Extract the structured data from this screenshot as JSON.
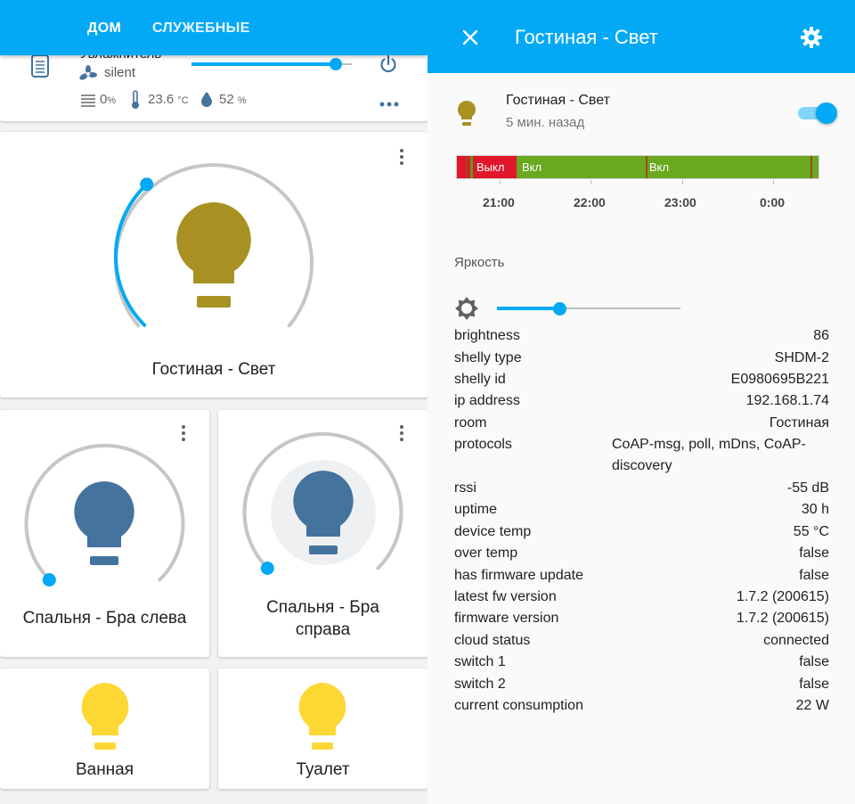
{
  "tabs": [
    "ДОМ",
    "СЛУЖЕБНЫЕ"
  ],
  "humidifier": {
    "label": "Увлажнитель",
    "mode": "silent",
    "water_value": "0",
    "water_unit": "%",
    "temp_value": "23.6",
    "temp_unit": "°C",
    "humidity_value": "52",
    "humidity_unit": "%",
    "slider_fraction": 0.9
  },
  "lights": {
    "living": {
      "name": "Гостиная - Свет",
      "brightness_fraction": 0.34
    },
    "bed_left": {
      "name": "Спальня - Бра слева",
      "brightness_fraction": 0.0
    },
    "bed_right": {
      "name": "Спальня - Бра справа",
      "brightness_fraction": 0.0
    },
    "bath": {
      "name": "Ванная"
    },
    "toilet": {
      "name": "Туалет"
    }
  },
  "dialog": {
    "title": "Гостиная - Свет",
    "entity_name": "Гостиная - Свет",
    "last_changed": "5 мин. назад",
    "toggle_on": true,
    "timeline": {
      "segments": [
        {
          "label": "Выкл",
          "state": "off"
        },
        {
          "label": "Вкл",
          "state": "on"
        },
        {
          "label": "Вкл",
          "state": "on"
        }
      ],
      "ticks": [
        "21:00",
        "22:00",
        "23:00",
        "0:00"
      ]
    },
    "brightness_label": "Яркость",
    "brightness_slider_fraction": 0.34,
    "attributes": [
      {
        "key": "brightness",
        "value": "86"
      },
      {
        "key": "shelly type",
        "value": "SHDM-2"
      },
      {
        "key": "shelly id",
        "value": "E0980695B221"
      },
      {
        "key": "ip address",
        "value": "192.168.1.74"
      },
      {
        "key": "room",
        "value": "Гостиная"
      },
      {
        "key": "protocols",
        "value": "CoAP-msg, poll, mDns, CoAP-discovery"
      },
      {
        "key": "rssi",
        "value": "-55 dB"
      },
      {
        "key": "uptime",
        "value": "30 h"
      },
      {
        "key": "device temp",
        "value": "55 °C"
      },
      {
        "key": "over temp",
        "value": "false"
      },
      {
        "key": "has firmware update",
        "value": "false"
      },
      {
        "key": "latest fw version",
        "value": "1.7.2 (200615)"
      },
      {
        "key": "firmware version",
        "value": "1.7.2 (200615)"
      },
      {
        "key": "cloud status",
        "value": "connected"
      },
      {
        "key": "switch 1",
        "value": "false"
      },
      {
        "key": "switch 2",
        "value": "false"
      },
      {
        "key": "current consumption",
        "value": "22 W"
      }
    ]
  },
  "colors": {
    "accent": "#03a9f4",
    "bulb_on_dim": "#a89122",
    "bulb_off": "#44739e",
    "bulb_on_bright": "#fdd835",
    "state_on": "#6aa81f",
    "state_off": "#e0162b"
  }
}
